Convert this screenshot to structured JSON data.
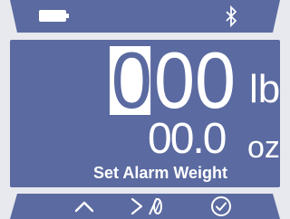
{
  "status": {
    "battery_icon": "battery-full-icon",
    "bluetooth_icon": "bluetooth-icon"
  },
  "weight": {
    "lb_digits": [
      "0",
      "0",
      "0"
    ],
    "selected_digit_index": 0,
    "lb_unit": "lb",
    "oz_value": "00.0",
    "oz_unit": "oz"
  },
  "caption": "Set Alarm Weight",
  "nav": {
    "up_icon": "chevron-up-icon",
    "next_zero_icon": "next-zero-icon",
    "confirm_icon": "check-circle-icon"
  },
  "colors": {
    "panel": "#5b6aa0",
    "background": "#e7e9ee",
    "foreground": "#ffffff"
  }
}
